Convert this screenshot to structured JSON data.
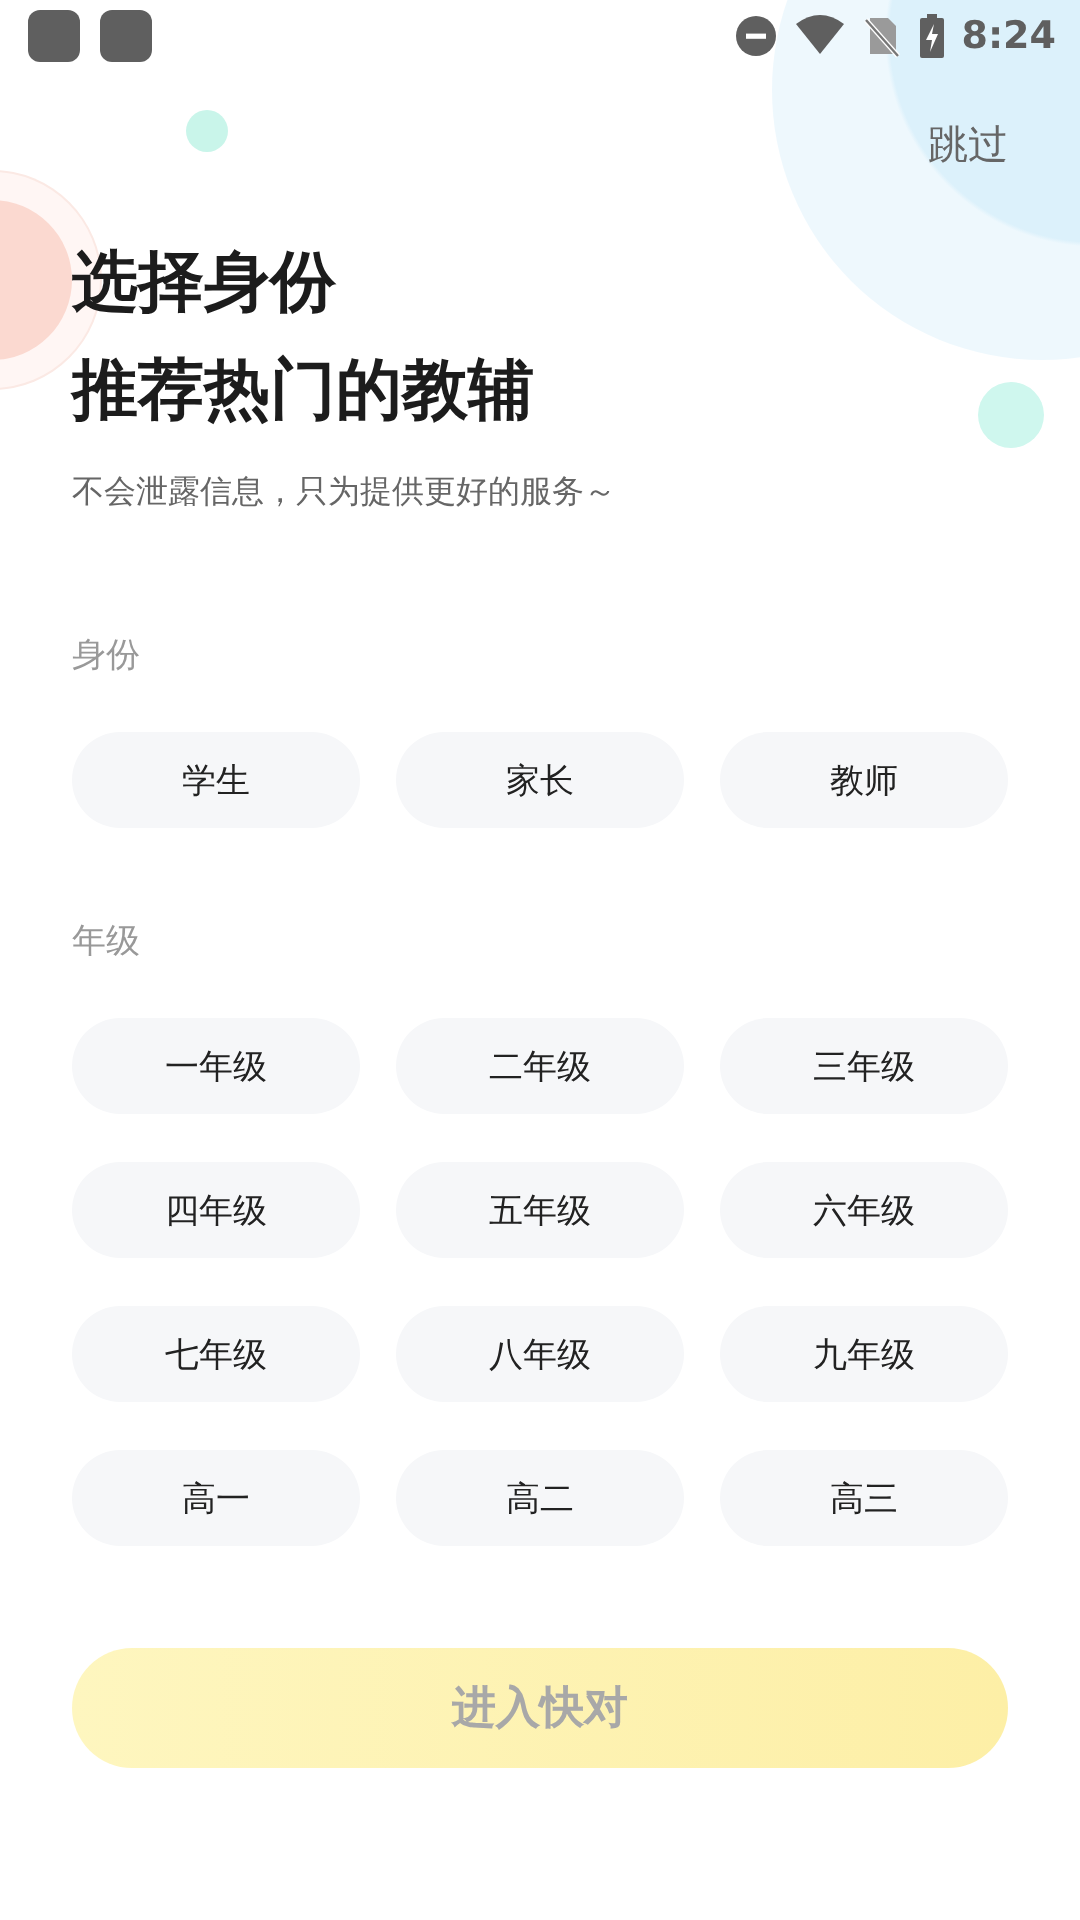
{
  "status_bar": {
    "time": "8:24"
  },
  "skip_label": "跳过",
  "title_lines": [
    "选择身份",
    "推荐热门的教辅"
  ],
  "subtitle": "不会泄露信息，只为提供更好的服务～",
  "sections": [
    {
      "label": "身份",
      "options": [
        {
          "label": "学生",
          "selected": false
        },
        {
          "label": "家长",
          "selected": false
        },
        {
          "label": "教师",
          "selected": false
        }
      ]
    },
    {
      "label": "年级",
      "options": [
        {
          "label": "一年级",
          "selected": false
        },
        {
          "label": "二年级",
          "selected": false
        },
        {
          "label": "三年级",
          "selected": false
        },
        {
          "label": "四年级",
          "selected": false
        },
        {
          "label": "五年级",
          "selected": false
        },
        {
          "label": "六年级",
          "selected": false
        },
        {
          "label": "七年级",
          "selected": false
        },
        {
          "label": "八年级",
          "selected": false
        },
        {
          "label": "九年级",
          "selected": false
        },
        {
          "label": "高一",
          "selected": false
        },
        {
          "label": "高二",
          "selected": false
        },
        {
          "label": "高三",
          "selected": false
        }
      ]
    }
  ],
  "submit": {
    "label": "进入快对",
    "disabled": true
  }
}
